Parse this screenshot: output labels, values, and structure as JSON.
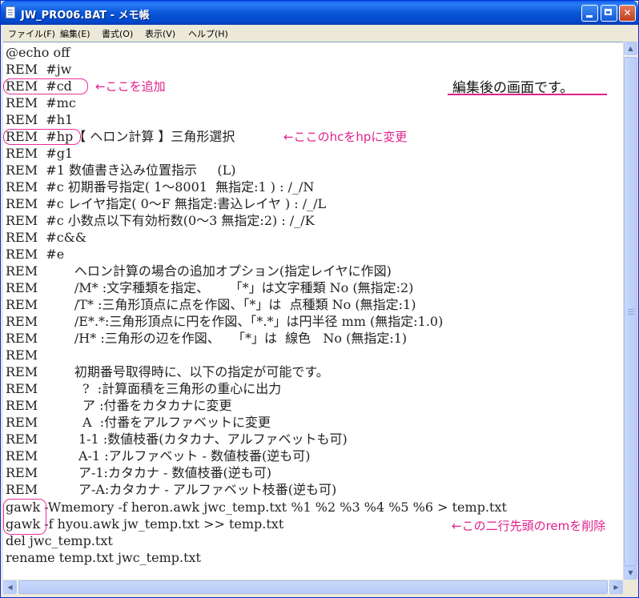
{
  "window": {
    "title": "JW_PRO06.BAT - メモ帳",
    "minimize_label": "",
    "close_label": "✕"
  },
  "menu": [
    "ファイル(F)",
    "編集(E)",
    "書式(O)",
    "表示(V)",
    "ヘルプ(H)"
  ],
  "lines": [
    "@echo off",
    "REM  #jw",
    "REM  #cd",
    "REM  #mc",
    "REM  #h1",
    "REM  #hp【 ヘロン計算 】三角形選択",
    "REM  #g1",
    "REM  #1 数値書き込み位置指示     (L)",
    "REM  #c 初期番号指定( 1～8001  無指定:1 ) : /_/N",
    "REM  #c レイヤ指定( 0～F 無指定:書込レイヤ ) : /_/L",
    "REM  #c 小数点以下有効桁数(0～3 無指定:2) : /_/K",
    "REM  #c&&",
    "REM  #e",
    "REM         ヘロン計算の場合の追加オプション(指定レイヤに作図)",
    "REM         /M* :文字種類を指定、     「*」は文字種類 No (無指定:2)",
    "REM         /T* :三角形頂点に点を作図、「*」は  点種類 No (無指定:1)",
    "REM         /E*.*:三角形頂点に円を作図、「*.*」は円半径 mm (無指定:1.0)",
    "REM         /H* :三角形の辺を作図、   「*」は  線色   No (無指定:1)",
    "REM",
    "REM         初期番号取得時に、以下の指定が可能です。",
    "REM           ?  :計算面積を三角形の重心に出力",
    "REM           ア :付番をカタカナに変更",
    "REM           A  :付番をアルファベットに変更",
    "REM          1-1 :数値枝番(カタカナ、アルファベットも可)",
    "REM          A-1 :アルファベット - 数値枝番(逆も可)",
    "REM          ア-1:カタカナ - 数値枝番(逆も可)",
    "REM          ア-A:カタカナ - アルファベット枝番(逆も可)",
    "gawk -Wmemory -f heron.awk jwc_temp.txt %1 %2 %3 %4 %5 %6 > temp.txt",
    "gawk -f hyou.awk jw_temp.txt >> temp.txt",
    "del jwc_temp.txt",
    "rename temp.txt jwc_temp.txt"
  ],
  "annotations": {
    "add_here": "←ここを追加",
    "change_hc": "←ここのhcをhpに変更",
    "delete_rem": "←この二行先頭のremを削除",
    "note": "編集後の画面です。"
  },
  "colors": {
    "annotation": "#e0208a",
    "titlebar": "#0a57d8"
  }
}
